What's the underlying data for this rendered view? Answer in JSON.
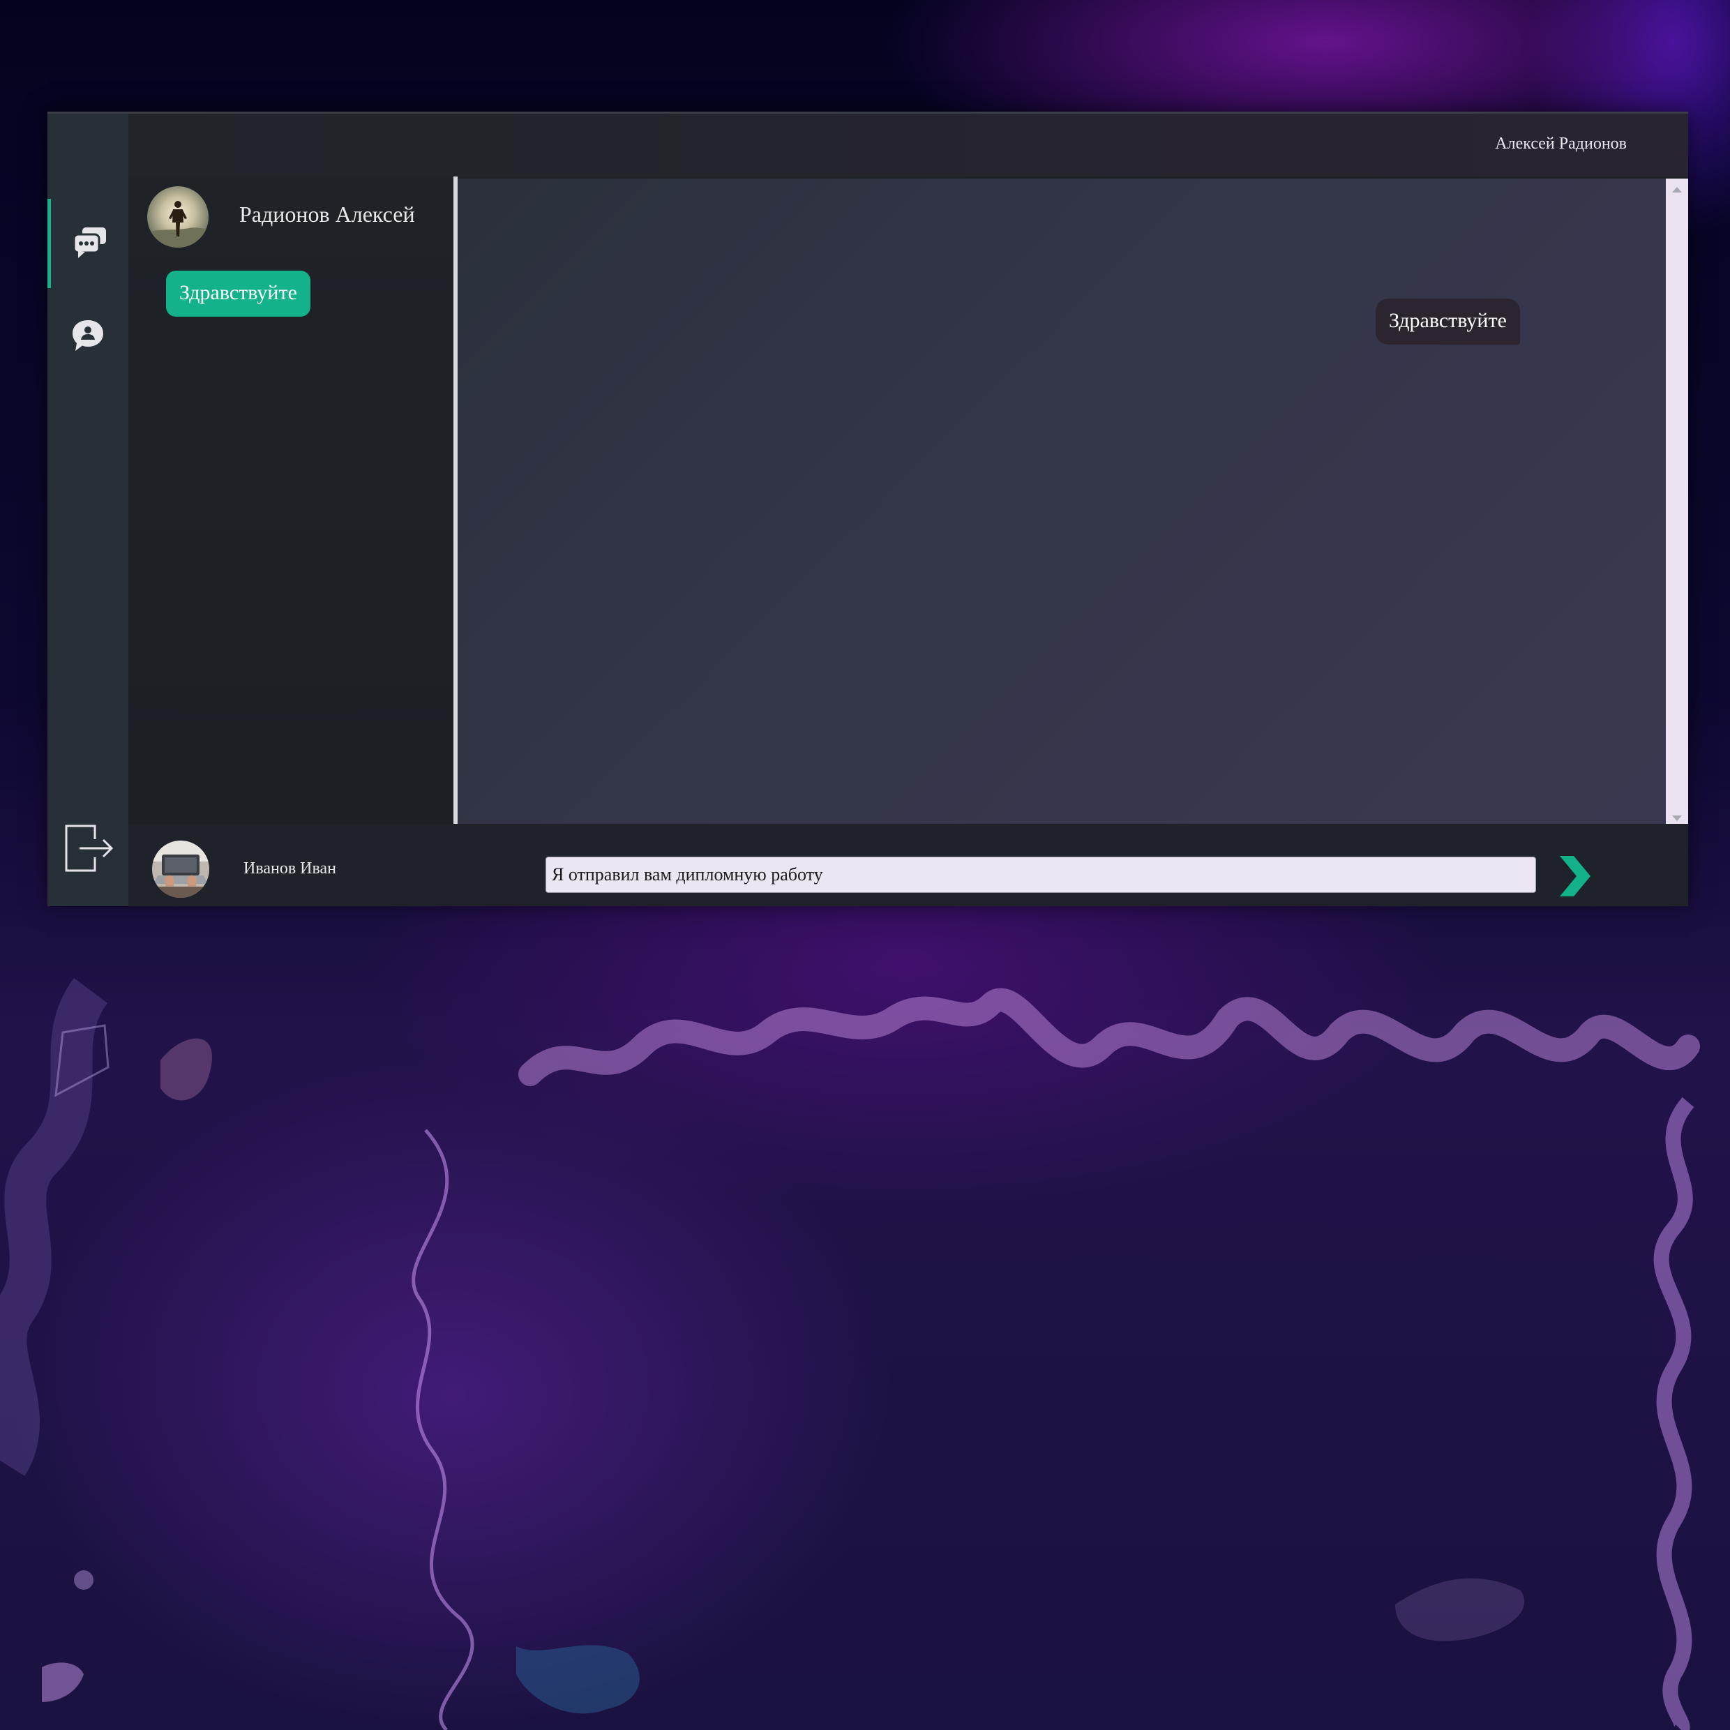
{
  "header": {
    "current_user": "Алексей Радионов"
  },
  "sidebar": {
    "nav": [
      {
        "name": "chats",
        "icon": "chat-bubbles-icon",
        "active": true
      },
      {
        "name": "contacts",
        "icon": "user-chat-icon",
        "active": false
      }
    ],
    "logout_icon": "logout-icon"
  },
  "contacts": [
    {
      "name": "Радионов Алексей",
      "avatar": "avatar-man-sunset"
    }
  ],
  "chat": {
    "messages": [
      {
        "direction": "outgoing",
        "text": "Здравствуйте"
      },
      {
        "direction": "incoming",
        "text": "Здравствуйте"
      }
    ]
  },
  "composer": {
    "user_name": "Иванов Иван",
    "input_value": "Я отправил вам дипломную работу ",
    "send_icon": "chevron-right-icon"
  },
  "colors": {
    "accent": "#14b28a",
    "panel": "#1e2126",
    "chat_bg": "#333649",
    "incoming_bubble": "#2c2530"
  }
}
